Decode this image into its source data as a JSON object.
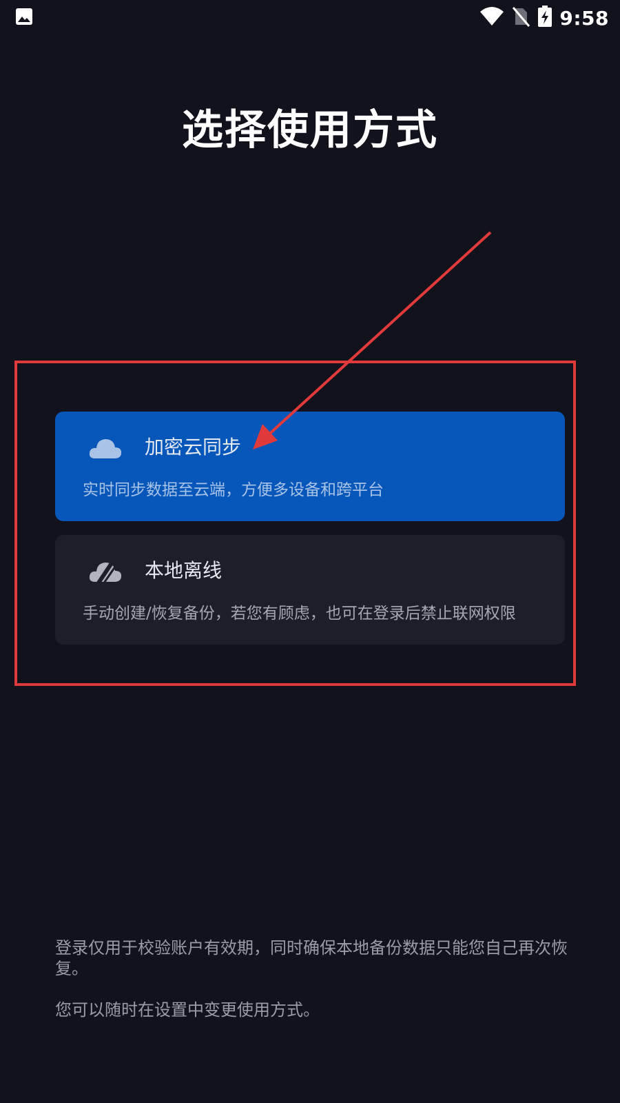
{
  "status_bar": {
    "time": "9:58",
    "icons": [
      "image-icon",
      "wifi-icon",
      "no-sim-icon",
      "battery-charging-icon"
    ]
  },
  "page": {
    "title": "选择使用方式"
  },
  "options": [
    {
      "title": "加密云同步",
      "description": "实时同步数据至云端，方便多设备和跨平台",
      "icon": "cloud-icon",
      "selected": true,
      "background": "#0757bb"
    },
    {
      "title": "本地离线",
      "description": "手动创建/恢复备份，若您有顾虑，也可在登录后禁止联网权限",
      "icon": "cloud-off-icon",
      "selected": false,
      "background": "#1e1e28"
    }
  ],
  "footer": {
    "note": "登录仅用于校验账户有效期，同时确保本地备份数据只能您自己再次恢复。",
    "hint": "您可以随时在设置中变更使用方式。"
  },
  "annotation": {
    "color": "#e03a3a"
  }
}
